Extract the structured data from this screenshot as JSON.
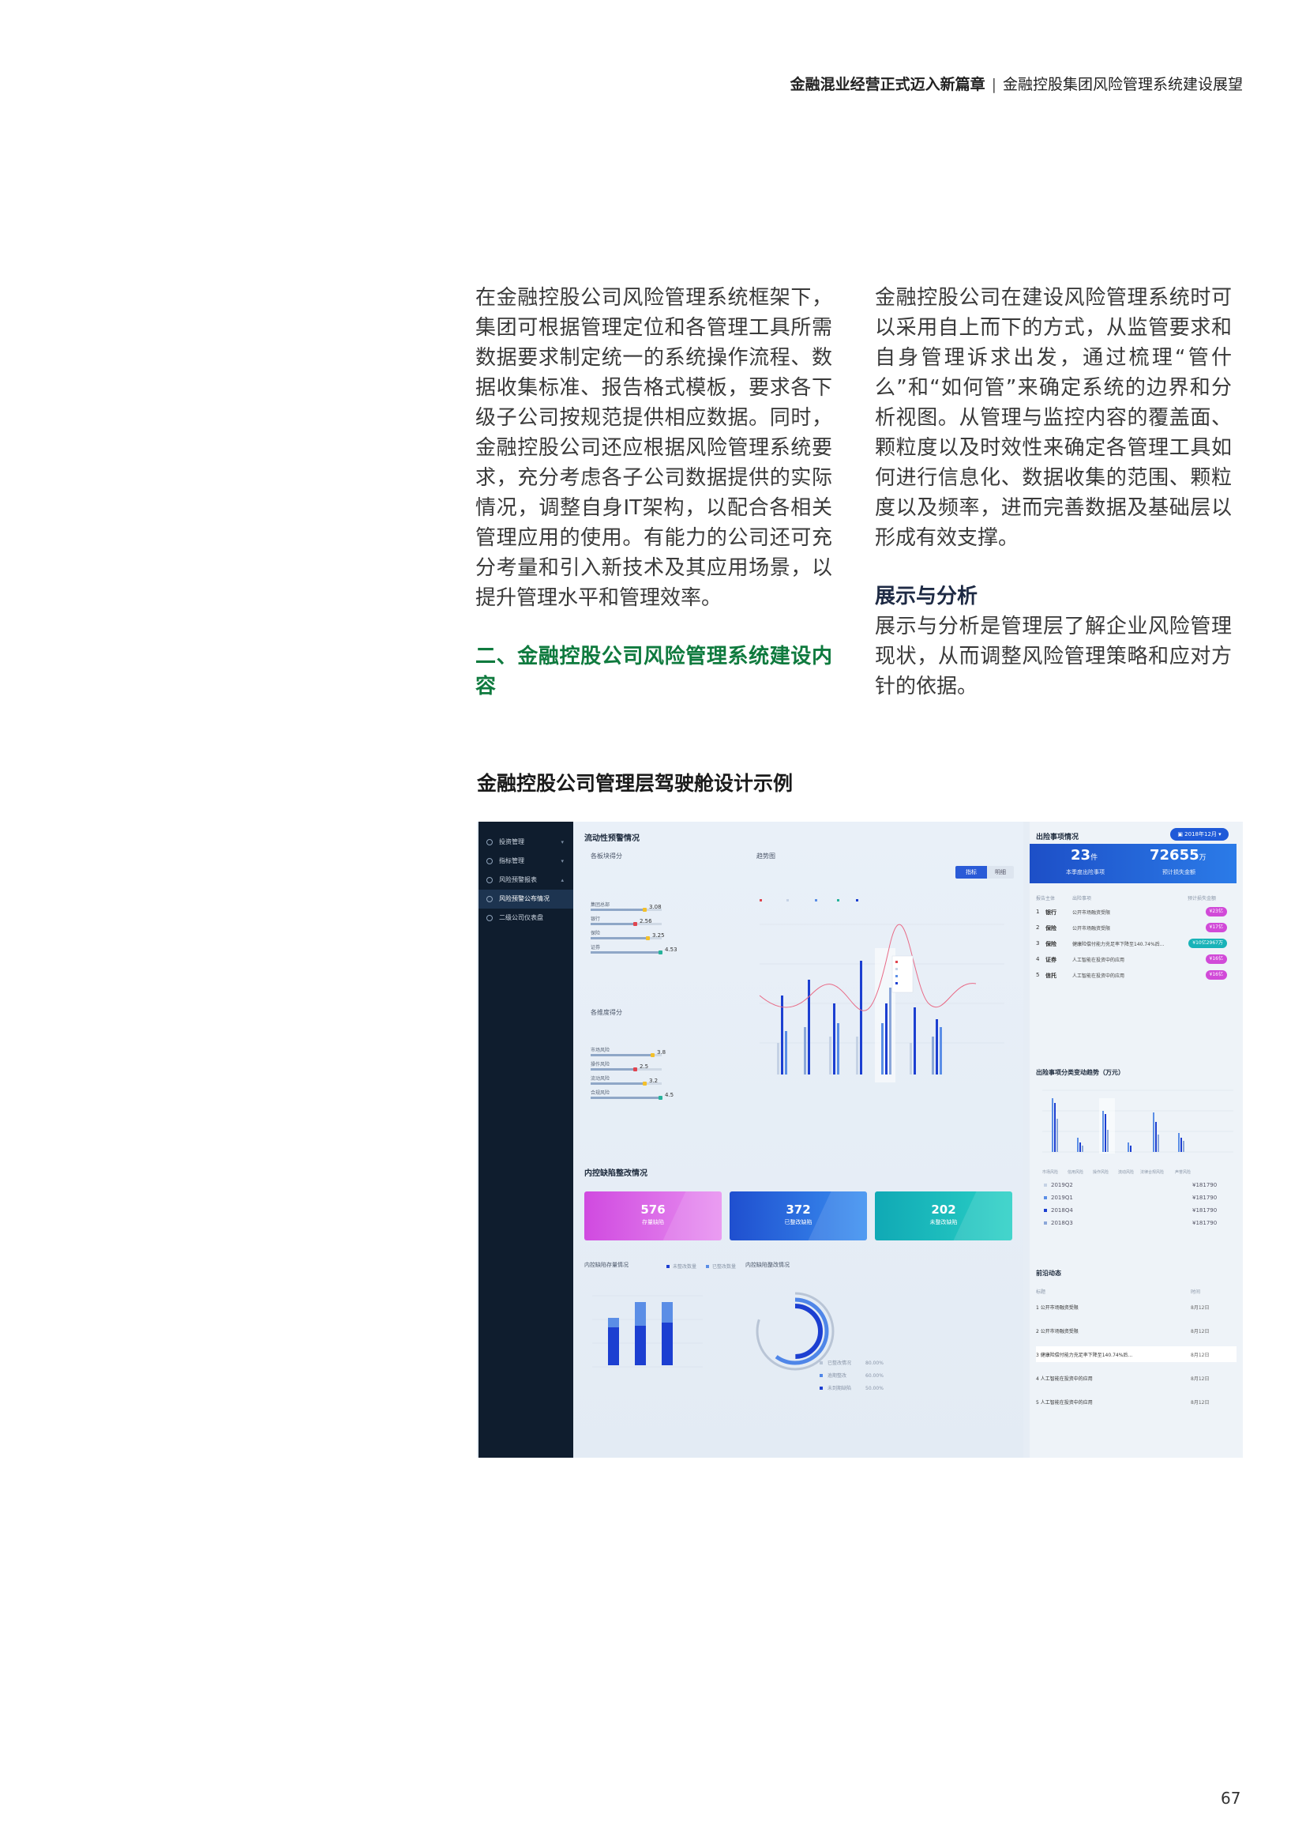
{
  "header": {
    "left": "金融混业经营正式迈入新篇章",
    "separator": "|",
    "right": "金融控股集团风险管理系统建设展望"
  },
  "left_column": {
    "paragraph": "在金融控股公司风险管理系统框架下，集团可根据管理定位和各管理工具所需数据要求制定统一的系统操作流程、数据收集标准、报告格式模板，要求各下级子公司按规范提供相应数据。同时，金融控股公司还应根据风险管理系统要求，充分考虑各子公司数据提供的实际情况，调整自身IT架构，以配合各相关管理应用的使用。有能力的公司还可充分考量和引入新技术及其应用场景，以提升管理水平和管理效率。",
    "section_heading": "二、金融控股公司风险管理系统建设内容"
  },
  "right_column": {
    "paragraph": "金融控股公司在建设风险管理系统时可以采用自上而下的方式，从监管要求和自身管理诉求出发，通过梳理“管什么”和“如何管”来确定系统的边界和分析视图。从管理与监控内容的覆盖面、颗粒度以及时效性来确定各管理工具如何进行信息化、数据收集的范围、颗粒度以及频率，进而完善数据及基础层以形成有效支撑。",
    "sub_heading": "展示与分析",
    "sub_paragraph": "展示与分析是管理层了解企业风险管理现状，从而调整风险管理策略和应对方针的依据。"
  },
  "figure": {
    "caption": "金融控股公司管理层驾驶舱设计示例",
    "dashboard": {
      "sidebar": [
        {
          "label": "投资管理",
          "arrow": "▾"
        },
        {
          "label": "指标管理",
          "arrow": "▾"
        },
        {
          "label": "风险预警报表",
          "arrow": "▴"
        },
        {
          "label": "风险预警公布情况",
          "arrow": ""
        },
        {
          "label": "二级公司仪表盘",
          "arrow": ""
        }
      ],
      "liquidity": {
        "title": "流动性预警情况",
        "score_title": "各板块得分",
        "score_rows": [
          {
            "label": "集团总部",
            "value": "3.08",
            "color": "#f3c02b"
          },
          {
            "label": "银行",
            "value": "2.56",
            "color": "#e0454f"
          },
          {
            "label": "保险",
            "value": "3.25",
            "color": "#f3c02b"
          },
          {
            "label": "证券",
            "value": "4.53",
            "color": "#27b39b"
          }
        ],
        "score_title_2": "各维度得分",
        "score_rows_2": [
          {
            "label": "市场风险",
            "value": "3.8",
            "color": "#f3c02b"
          },
          {
            "label": "操作风险",
            "value": "2.5",
            "color": "#e0454f"
          },
          {
            "label": "流动风险",
            "value": "3.2",
            "color": "#f3c02b"
          },
          {
            "label": "合规风险",
            "value": "4.5",
            "color": "#27b39b"
          }
        ],
        "trend_title": "趋势图",
        "toggle_on": "指标",
        "toggle_off": "明细"
      },
      "defects": {
        "title": "内控缺陷整改情况",
        "cards": [
          {
            "value": "576",
            "label": "存量缺陷"
          },
          {
            "value": "372",
            "label": "已整改缺陷"
          },
          {
            "value": "202",
            "label": "未整改缺陷"
          }
        ],
        "stock_title": "内控缺陷存量情况",
        "legend_a": "未整改数量",
        "legend_b": "已整改数量",
        "rect_title": "内控缺陷整改情况",
        "ring_rows": [
          {
            "label": "已整改情况",
            "value": "80.00%",
            "color": "#b9c5d6"
          },
          {
            "label": "逾期整改",
            "value": "60.00%",
            "color": "#4f86e8"
          },
          {
            "label": "未到期缺陷",
            "value": "50.00%",
            "color": "#1c3fd1"
          }
        ]
      },
      "events": {
        "title": "出险事项情况",
        "date": "2018年12月",
        "count": "23",
        "count_unit": "件",
        "count_label": "本季度出险事项",
        "amount": "72655",
        "amount_unit": "万",
        "amount_label": "预计损失金额",
        "col_a": "报告主体",
        "col_b": "出险事项",
        "col_c": "预计损失金额",
        "rows": [
          {
            "rank": "1",
            "entity": "银行",
            "desc": "公开市场融资受限",
            "amount": "¥23亿",
            "color": "#d14ad8"
          },
          {
            "rank": "2",
            "entity": "保险",
            "desc": "公开市场融资受限",
            "amount": "¥17亿",
            "color": "#d14ad8"
          },
          {
            "rank": "3",
            "entity": "保险",
            "desc": "健康险偿付能力充足率下降至140.74%后...",
            "amount": "¥10亿2967万",
            "color": "#19b3b8"
          },
          {
            "rank": "4",
            "entity": "证券",
            "desc": "人工智能在投资中的应用",
            "amount": "¥16亿",
            "color": "#d14ad8"
          },
          {
            "rank": "5",
            "entity": "信托",
            "desc": "人工智能在投资中的应用",
            "amount": "¥16亿",
            "color": "#d14ad8"
          }
        ]
      },
      "trend": {
        "title": "出险事项分类变动趋势（万元）",
        "categories": [
          "市场风险",
          "信用风险",
          "操作风险",
          "流动风险",
          "法律合规风险",
          "声誉风险"
        ],
        "legend": [
          {
            "label": "2019Q2",
            "value": "¥181790",
            "color": "#c5d2e5"
          },
          {
            "label": "2019Q1",
            "value": "¥181790",
            "color": "#5b8ee6"
          },
          {
            "label": "2018Q4",
            "value": "¥181790",
            "color": "#1c3fd1"
          },
          {
            "label": "2018Q3",
            "value": "¥181790",
            "color": "#8ba7d9"
          }
        ]
      },
      "news": {
        "title": "前沿动态",
        "col_title": "标题",
        "col_time": "时间",
        "rows": [
          {
            "title": "1 公开市场融资受限",
            "date": "8月12日"
          },
          {
            "title": "2 公开市场融资受限",
            "date": "8月12日"
          },
          {
            "title": "3 健康险偿付能力充足率下降至140.74%后...",
            "date": "8月12日"
          },
          {
            "title": "4 人工智能在投资中的应用",
            "date": "8月12日"
          },
          {
            "title": "5 人工智能在投资中的应用",
            "date": "8月12日"
          }
        ]
      }
    }
  },
  "page_number": "67"
}
